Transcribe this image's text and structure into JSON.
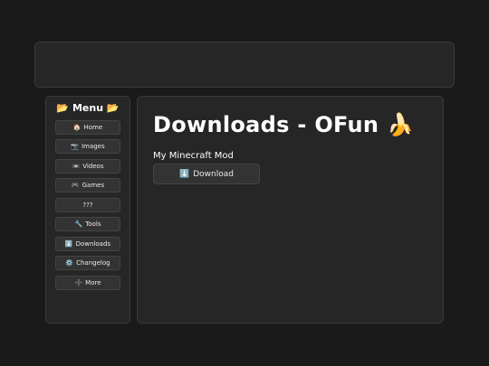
{
  "sidebar": {
    "title": "Menu",
    "title_icon": "folder-open-icon",
    "items": [
      {
        "label": "Home",
        "icon": "house-icon",
        "glyph": "🏠"
      },
      {
        "label": "Images",
        "icon": "camera-icon",
        "glyph": "📷"
      },
      {
        "label": "Videos",
        "icon": "videocassette-icon",
        "glyph": "📼"
      },
      {
        "label": "Games",
        "icon": "gamepad-icon",
        "glyph": "🎮"
      },
      {
        "label": "???",
        "icon": "",
        "glyph": ""
      },
      {
        "label": "Tools",
        "icon": "wrench-icon",
        "glyph": "🔧"
      },
      {
        "label": "Downloads",
        "icon": "down-arrow-icon",
        "glyph": "⬇️"
      },
      {
        "label": "Changelog",
        "icon": "gear-icon",
        "glyph": "⚙️"
      },
      {
        "label": "More",
        "icon": "plus-icon",
        "glyph": "➕"
      }
    ]
  },
  "main": {
    "title": "Downloads - OFun",
    "title_icon": "banana-icon",
    "mod_label": "My Minecraft Mod",
    "download_button": {
      "label": "Download",
      "icon": "down-arrow-icon"
    }
  },
  "colors": {
    "background": "#1a1a1a",
    "panel": "#262626",
    "button": "#333333",
    "text": "#ffffff"
  }
}
